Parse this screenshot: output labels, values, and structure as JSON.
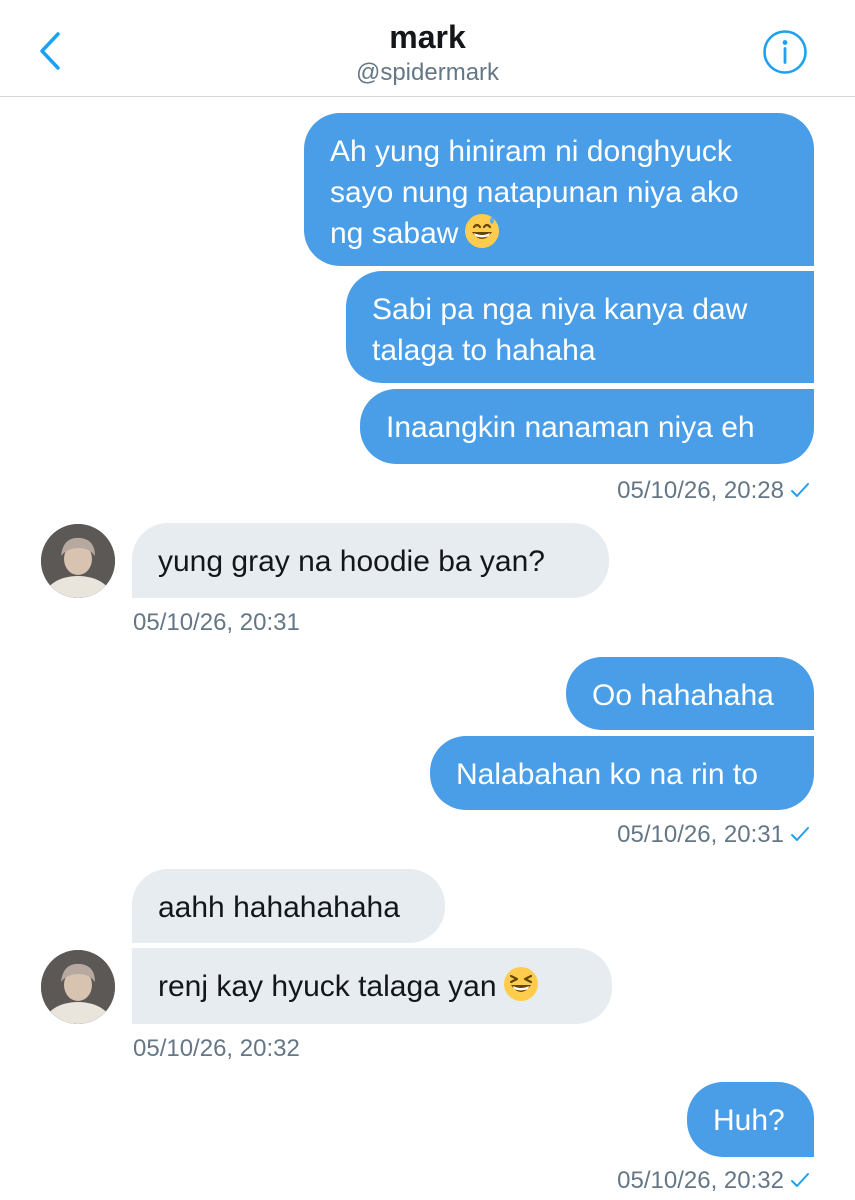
{
  "header": {
    "title": "mark",
    "handle": "@spidermark",
    "back_icon": "chevron-left-icon",
    "info_icon": "info-icon",
    "accent_color": "#1da1f2"
  },
  "colors": {
    "sent_bubble": "#4a9ee8",
    "received_bubble": "#e6ecf0",
    "timestamp": "#657786"
  },
  "messages": [
    {
      "direction": "sent",
      "bubbles": [
        {
          "lines": [
            "Ah yung hiniram ni donghyuck",
            "sayo nung natapunan niya ako",
            "ng sabaw"
          ],
          "emoji": "grinning-face-with-sweat-icon"
        },
        {
          "lines": [
            "Sabi pa nga niya kanya daw",
            "talaga to hahaha"
          ]
        },
        {
          "lines": [
            "Inaangkin nanaman niya eh"
          ]
        }
      ],
      "timestamp": "05/10/26, 20:28",
      "status_icon": "checkmark-icon"
    },
    {
      "direction": "received",
      "bubbles": [
        {
          "lines": [
            "yung gray na hoodie ba yan?"
          ]
        }
      ],
      "timestamp": "05/10/26, 20:31"
    },
    {
      "direction": "sent",
      "bubbles": [
        {
          "lines": [
            "Oo hahahaha"
          ]
        },
        {
          "lines": [
            "Nalabahan ko na rin to"
          ]
        }
      ],
      "timestamp": "05/10/26, 20:31",
      "status_icon": "checkmark-icon"
    },
    {
      "direction": "received",
      "bubbles": [
        {
          "lines": [
            "aahh hahahahaha"
          ]
        },
        {
          "lines": [
            "renj kay hyuck talaga yan"
          ],
          "emoji": "laughing-squinting-face-icon"
        }
      ],
      "timestamp": "05/10/26, 20:32"
    },
    {
      "direction": "sent",
      "bubbles": [
        {
          "lines": [
            "Huh?"
          ]
        }
      ],
      "timestamp": "05/10/26, 20:32",
      "status_icon": "checkmark-icon"
    }
  ]
}
